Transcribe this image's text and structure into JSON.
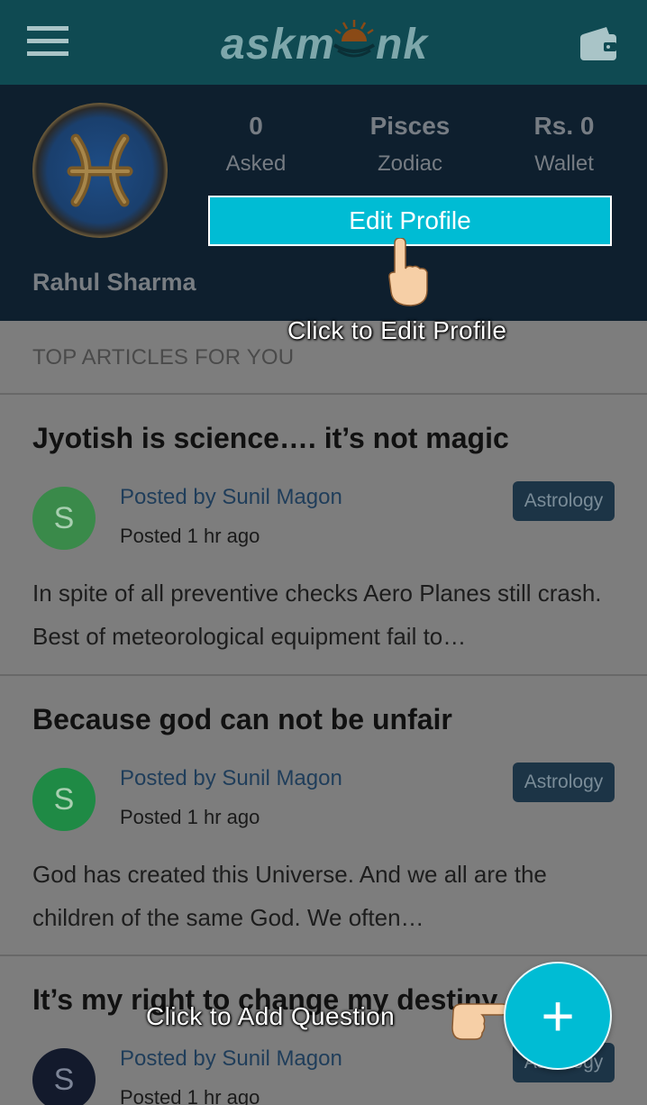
{
  "appbar": {
    "logo_text_left": "askm",
    "logo_text_right": "nk",
    "icons": {
      "menu": "menu-icon",
      "wallet": "wallet-icon"
    }
  },
  "profile": {
    "stats": [
      {
        "value": "0",
        "label": "Asked"
      },
      {
        "value": "Pisces",
        "label": "Zodiac"
      },
      {
        "value": "Rs. 0",
        "label": "Wallet"
      }
    ],
    "edit_button": "Edit Profile",
    "name": "Rahul Sharma"
  },
  "section_title": "TOP ARTICLES FOR YOU",
  "articles": [
    {
      "title": "Jyotish is science…. it’s not magic",
      "avatar_letter": "S",
      "avatar_color": "#3a8a4a",
      "author": "Posted by Sunil Magon",
      "time": "Posted 1 hr ago",
      "tag": "Astrology",
      "body": "In spite of all preventive checks Aero Planes still crash. Best of meteorological equipment fail to…"
    },
    {
      "title": "Because god can not be unfair",
      "avatar_letter": "S",
      "avatar_color": "#1f8a45",
      "author": "Posted by Sunil Magon",
      "time": "Posted 1 hr ago",
      "tag": "Astrology",
      "body": "God has created this Universe. And we all are the children of the same God. We often…"
    },
    {
      "title": "It’s my right to change my destiny",
      "avatar_letter": "S",
      "avatar_color": "#131a2c",
      "author": "Posted by Sunil Magon",
      "time": "Posted 1 hr ago",
      "tag": "Astrology"
    }
  ],
  "hints": {
    "edit_profile": "Click to Edit Profile",
    "add_question": "Click to Add Question"
  },
  "fab_label": "+",
  "colors": {
    "accent": "#00bcd4",
    "appbar": "#0f4a52",
    "profile_bg": "#0e1f2e"
  }
}
